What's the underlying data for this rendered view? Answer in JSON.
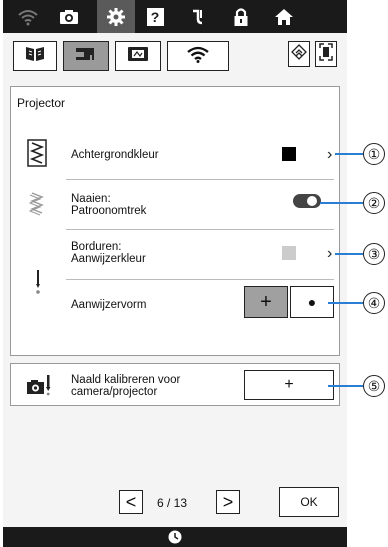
{
  "topbar": {
    "icons": [
      "wifi-icon",
      "camera-icon",
      "gear-icon",
      "help-icon",
      "needle-thread-icon",
      "lock-icon",
      "home-icon"
    ],
    "active": "gear-icon"
  },
  "tabs": {
    "items": [
      "book-icon",
      "sewing-machine-icon",
      "embroidery-frame-icon",
      "wifi-icon"
    ],
    "active": "sewing-machine-icon"
  },
  "panel": {
    "title": "Projector",
    "rows": {
      "background": {
        "label": "Achtergrondkleur",
        "color": "#000000"
      },
      "sewing": {
        "label_line1": "Naaien:",
        "label_line2": "Patroonomtrek",
        "toggle_on": false
      },
      "embroidery": {
        "label_line1": "Borduren:",
        "label_line2": "Aanwijzerkleur",
        "color": "#cccccc"
      },
      "pointer_shape": {
        "label": "Aanwijzervorm",
        "options": [
          "+",
          "●"
        ],
        "selected": "+"
      }
    }
  },
  "calibrate": {
    "label_line1": "Naald kalibreren voor",
    "label_line2": "camera/projector",
    "button_label": "+"
  },
  "pager": {
    "prev": "<",
    "page": "6 / 13",
    "next": ">",
    "ok": "OK"
  },
  "callouts": [
    "①",
    "②",
    "③",
    "④",
    "⑤"
  ],
  "colors": {
    "accent_line": "#2a7fd4",
    "topbar_bg": "#1a1a1a"
  }
}
